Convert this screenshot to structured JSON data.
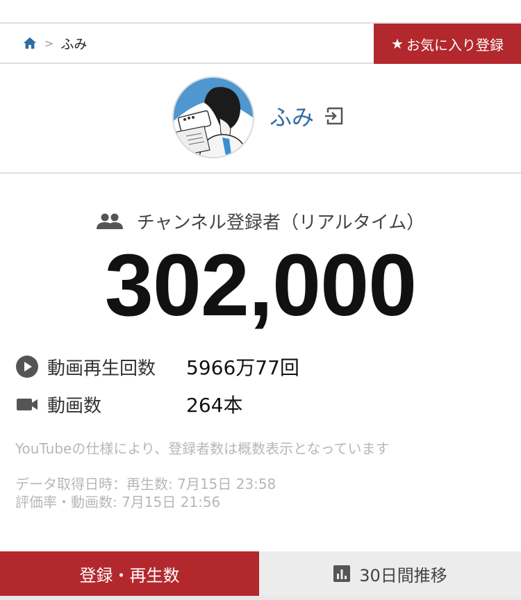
{
  "breadcrumb": {
    "current": "ふみ",
    "separator": ">"
  },
  "favorite_button": {
    "star": "★",
    "label": "お気に入り登録"
  },
  "channel": {
    "name": "ふみ"
  },
  "subscribers": {
    "label": "チャンネル登録者（リアルタイム）",
    "count": "302,000"
  },
  "stats": [
    {
      "icon": "play-circle-icon",
      "label": "動画再生回数",
      "value": "5966万77回"
    },
    {
      "icon": "video-camera-icon",
      "label": "動画数",
      "value": "264本"
    }
  ],
  "notes": {
    "approx": "YouTubeの仕様により、登録者数は概数表示となっています",
    "fetch_time": "データ取得日時：再生数: 7月15日 23:58",
    "rating_time": "評価率・動画数: 7月15日 21:56"
  },
  "tabs": [
    {
      "label": "登録・再生数",
      "active": true
    },
    {
      "label": "30日間推移",
      "active": false
    }
  ],
  "colors": {
    "brand_red": "#b3282d",
    "link_blue": "#2f6da3",
    "muted": "#b7b7b7"
  }
}
